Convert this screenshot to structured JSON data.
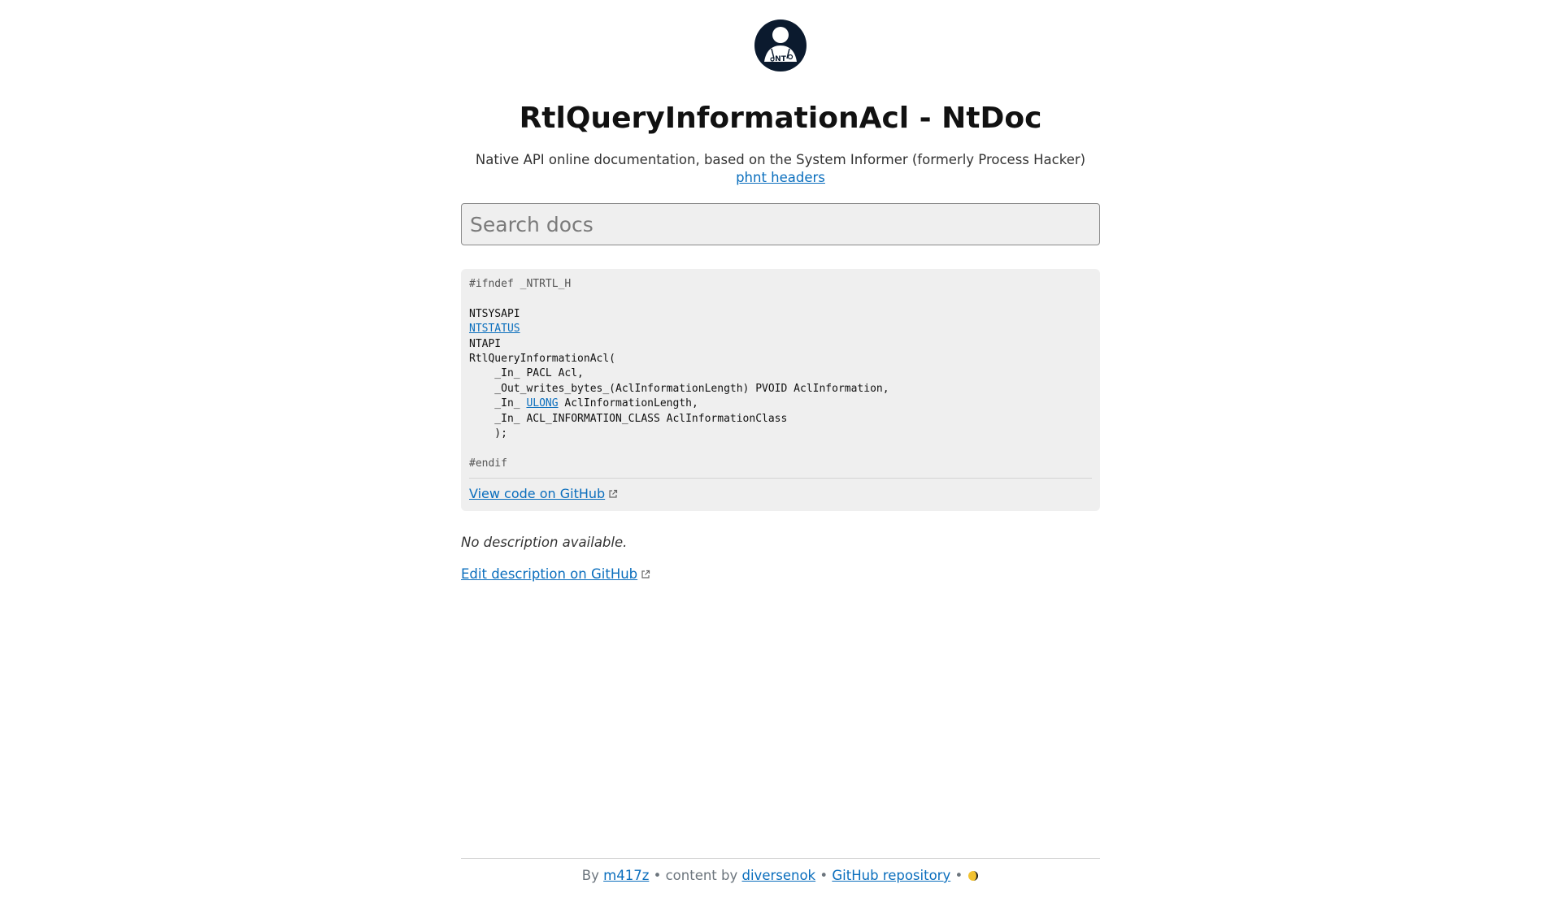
{
  "header": {
    "title": "RtlQueryInformationAcl - NtDoc",
    "subtitle_prefix": "Native API online documentation, based on the System Informer (formerly Process Hacker) ",
    "subtitle_link": "phnt headers",
    "logo_text": "NT"
  },
  "search": {
    "placeholder": "Search docs",
    "value": ""
  },
  "code": {
    "line_ifndef": "#ifndef _NTRTL_H",
    "line_ntsysapi": "NTSYSAPI",
    "type_ntstatus": "NTSTATUS",
    "line_ntapi": "NTAPI",
    "line_func": "RtlQueryInformationAcl(",
    "param1": "    _In_ PACL Acl,",
    "param2": "    _Out_writes_bytes_(AclInformationLength) PVOID AclInformation,",
    "param3_prefix": "    _In_ ",
    "param3_type": "ULONG",
    "param3_suffix": " AclInformationLength,",
    "param4": "    _In_ ACL_INFORMATION_CLASS AclInformationClass",
    "line_close": "    );",
    "line_endif": "#endif"
  },
  "links": {
    "view_code": "View code on GitHub",
    "edit_description": "Edit description on GitHub"
  },
  "description": "No description available.",
  "footer": {
    "by": "By ",
    "author": "m417z",
    "content_by": " • content by ",
    "content_author": "diversenok",
    "sep1": " • ",
    "repo": "GitHub repository",
    "sep2": " •"
  },
  "icons": {
    "logo": "nt-person-logo-icon",
    "external": "external-link-icon",
    "theme": "theme-toggle-moon-icon"
  },
  "colors": {
    "link": "#0a6ebd",
    "logo_bg": "#0b1a2e",
    "code_bg": "#efefef"
  }
}
